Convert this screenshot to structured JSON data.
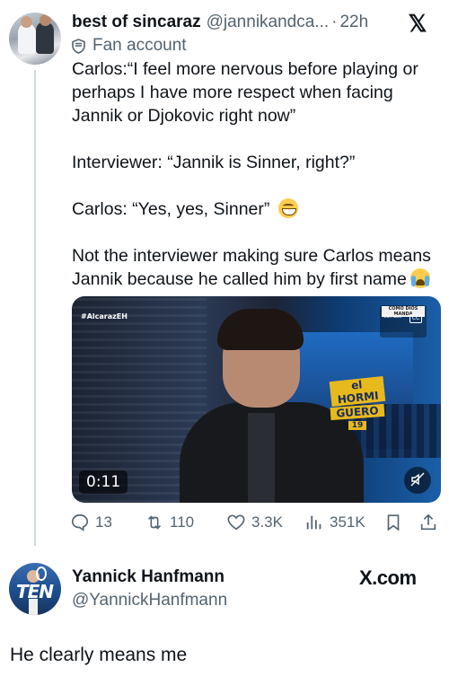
{
  "quoted_tweet": {
    "display_name": "best of sincaraz",
    "handle": "@jannikandca...",
    "separator": "·",
    "time": "22h",
    "label": "Fan account",
    "paragraphs": [
      "Carlos:“I feel more nervous before playing or perhaps I have more respect when facing Jannik or Djokovic right now”",
      "Interviewer: “Jannik is Sinner, right?”",
      "Carlos: “Yes, yes, Sinner”",
      "Not the interviewer making sure Carlos means Jannik because he called him by first name"
    ],
    "emojis": [
      "grinning-face-with-smiling-eyes",
      "loudly-crying-face"
    ],
    "video": {
      "overlay_hashtag": "#AlcarazEH",
      "show_logo_line1": "el HORMI",
      "show_logo_line2": "GUERO",
      "show_logo_line3": "19",
      "badge_line1": "COMO DIOS MANDA",
      "badge_line2": "Con Leo",
      "cc_label": "CC",
      "duration": "0:11"
    },
    "actions": {
      "replies": "13",
      "reposts": "110",
      "likes": "3.3K",
      "views": "351K"
    }
  },
  "reply_tweet": {
    "display_name": "Yannick Hanfmann",
    "handle": "@YannickHanfmann",
    "avatar_text": "TEN",
    "brand": "X.com",
    "text": "He clearly means me"
  },
  "colors": {
    "text_primary": "#0f1419",
    "text_secondary": "#536471",
    "thread_line": "#cfd9de"
  }
}
